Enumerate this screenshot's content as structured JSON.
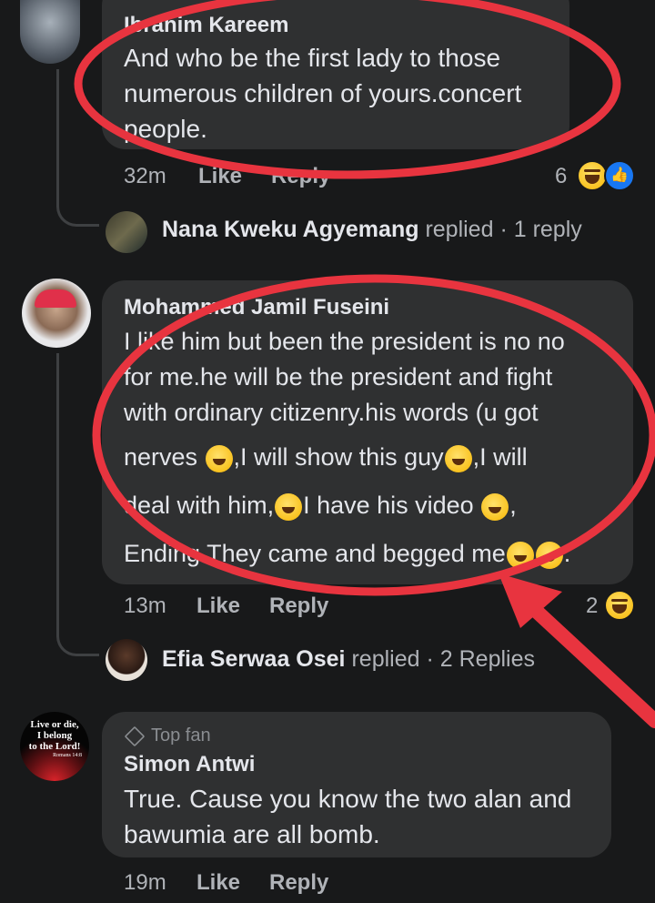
{
  "comments": [
    {
      "author": "Ibrahim Kareem",
      "lines": [
        "And who be the first lady to those",
        "numerous children of yours.concert",
        "people."
      ],
      "time": "32m",
      "like_label": "Like",
      "reply_label": "Reply",
      "reaction_count": "6",
      "replies": {
        "author": "Nana Kweku Agyemang",
        "action": "replied",
        "count": "· 1 reply"
      }
    },
    {
      "author": "Mohammed Jamil Fuseini",
      "lines": [
        "I like him but been the president is no no",
        "for me.he will be the president and fight",
        "with ordinary citizenry.his words (u got",
        "nerves ",
        ",I will show this guy",
        ",I will",
        "deal with him,",
        "I have his video ",
        ",",
        "Ending They came and begged me",
        "."
      ],
      "time": "13m",
      "like_label": "Like",
      "reply_label": "Reply",
      "reaction_count": "2",
      "replies": {
        "author": "Efia Serwaa Osei",
        "action": "replied",
        "count": "· 2 Replies"
      }
    },
    {
      "badge": "Top fan",
      "author": "Simon Antwi",
      "lines": [
        "True. Cause you know the two alan and",
        "bawumia are all bomb."
      ],
      "time": "19m",
      "like_label": "Like",
      "reply_label": "Reply",
      "avatar_text": [
        "Live or die,",
        "I belong",
        "to the Lord!",
        "Romans 14:8"
      ]
    }
  ],
  "colors": {
    "background": "#18191a",
    "bubble": "#2f3031",
    "annotation": "#e8343f",
    "like_blue": "#1877f2"
  }
}
